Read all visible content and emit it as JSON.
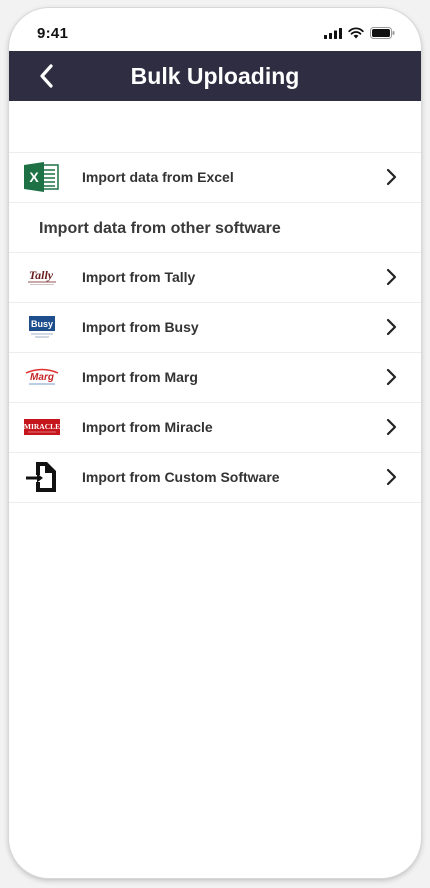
{
  "status": {
    "time": "9:41"
  },
  "header": {
    "title": "Bulk Uploading",
    "bg_color": "#2e2d42"
  },
  "excel_row": {
    "label": "Import data from Excel",
    "icon": "excel-icon"
  },
  "section": {
    "heading": "Import data from other software"
  },
  "rows": [
    {
      "label": "Import from Tally",
      "icon": "tally-logo",
      "logo_text": "Tally"
    },
    {
      "label": "Import from Busy",
      "icon": "busy-logo",
      "logo_text": "Busy"
    },
    {
      "label": "Import from Marg",
      "icon": "marg-logo",
      "logo_text": "Marg"
    },
    {
      "label": "Import from Miracle",
      "icon": "miracle-logo",
      "logo_text": "MIRACLE"
    },
    {
      "label": "Import from Custom Software",
      "icon": "file-import-icon"
    }
  ]
}
